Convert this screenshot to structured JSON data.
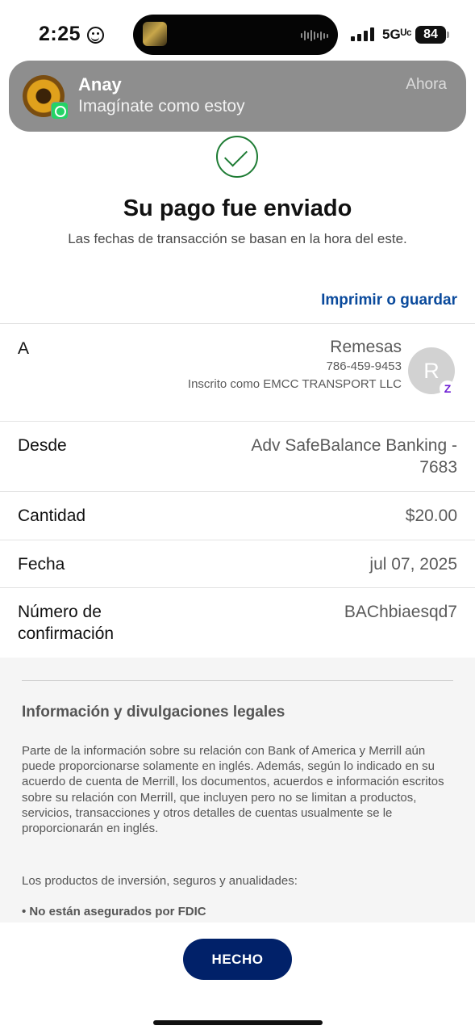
{
  "status_bar": {
    "time": "2:25",
    "network": "5Gᵁᶜ",
    "battery": "84"
  },
  "notification": {
    "app_icon": "whatsapp-icon",
    "sender": "Anay",
    "message": "Imagínate como estoy",
    "time": "Ahora"
  },
  "header": {
    "title": "Su pago fue enviado",
    "subtitle": "Las fechas de transacción se basan en la hora del este.",
    "print_link": "Imprimir o guardar"
  },
  "details": {
    "to": {
      "label": "A",
      "name": "Remesas",
      "phone": "786-459-9453",
      "enrolled_as": "Inscrito como EMCC TRANSPORT LLC",
      "avatar_initial": "R",
      "badge": "Z"
    },
    "from": {
      "label": "Desde",
      "value": "Adv SafeBalance Banking - 7683"
    },
    "amount": {
      "label": "Cantidad",
      "value": "$20.00"
    },
    "date": {
      "label": "Fecha",
      "value": "jul 07, 2025"
    },
    "confirmation": {
      "label": "Número de confirmación",
      "value": "BAChbiaesqd7"
    }
  },
  "legal": {
    "title": "Información y divulgaciones legales",
    "paragraph": "Parte de la información sobre su relación con Bank of America y Merrill aún puede proporcionarse solamente en inglés. Además, según lo indicado en su acuerdo de cuenta de Merrill, los documentos, acuerdos e información escritos sobre su relación con Merrill, que incluyen pero no se limitan a productos, servicios, transacciones y otros detalles de cuentas usualmente se le proporcionarán en inglés.",
    "products_intro": "Los productos de inversión, seguros y anualidades:",
    "bullet_1": "• No están asegurados por FDIC"
  },
  "footer": {
    "done_label": "HECHO"
  },
  "colors": {
    "accent_navy": "#012169",
    "link_blue": "#0a4a9c",
    "success_green": "#1e7c34",
    "zelle_purple": "#6d1ed4"
  }
}
